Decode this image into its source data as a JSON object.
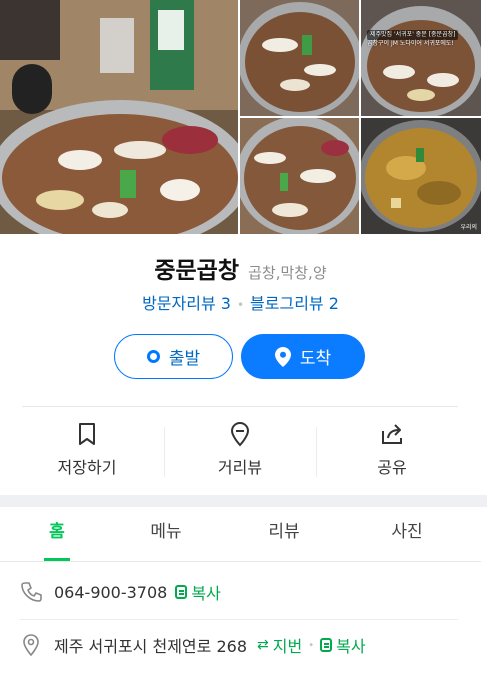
{
  "photos": {
    "photo_b_overlay_line1": "제주맛집 '서귀포' 중문 [중문곱창]",
    "photo_b_overlay_line2": "곱창구이 JM 노다이어 서귀포에도!",
    "photo_d_watermark": "우리의"
  },
  "place": {
    "name": "중문곱창",
    "category": "곱창,막창,양"
  },
  "reviews": {
    "visitor_label": "방문자리뷰 3",
    "blog_label": "블로그리뷰 2"
  },
  "route": {
    "start_label": "출발",
    "arrive_label": "도착"
  },
  "actions": {
    "save_label": "저장하기",
    "street_label": "거리뷰",
    "share_label": "공유"
  },
  "tabs": [
    {
      "label": "홈",
      "active": true
    },
    {
      "label": "메뉴",
      "active": false
    },
    {
      "label": "리뷰",
      "active": false
    },
    {
      "label": "사진",
      "active": false
    }
  ],
  "info": {
    "phone": "064-900-3708",
    "copy_label": "복사",
    "address": "제주 서귀포시 천제연로 268",
    "jibun_label": "지번",
    "address_copy_label": "복사"
  },
  "colors": {
    "brand_blue": "#0b7cff",
    "link_blue": "#0068c3",
    "naver_green": "#03c75a"
  }
}
